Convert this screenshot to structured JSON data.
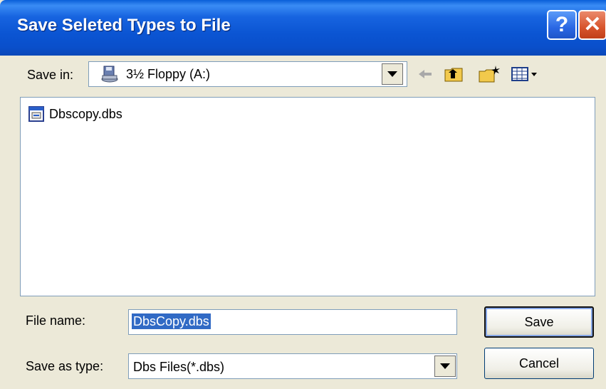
{
  "window": {
    "title": "Save Seleted Types to File",
    "help_glyph": "?",
    "close_glyph": "✕"
  },
  "save_in": {
    "label": "Save in:",
    "value": "3½ Floppy (A:)",
    "icon": "floppy-drive-icon"
  },
  "toolbar": {
    "icons": [
      "back-arrow-icon",
      "up-folder-icon",
      "new-folder-icon",
      "view-menu-icon"
    ]
  },
  "file_list": {
    "items": [
      {
        "name": "Dbscopy.dbs",
        "icon": "dbs-file-icon"
      }
    ]
  },
  "file_name": {
    "label": "File name:",
    "value": "DbsCopy.dbs"
  },
  "save_as_type": {
    "label": "Save as type:",
    "value": "Dbs Files(*.dbs)"
  },
  "buttons": {
    "save": "Save",
    "cancel": "Cancel"
  },
  "colors": {
    "titlebar": "#0a55d3",
    "dialog_bg": "#ece9d8",
    "selection": "#316ac5",
    "close": "#d8542c"
  }
}
